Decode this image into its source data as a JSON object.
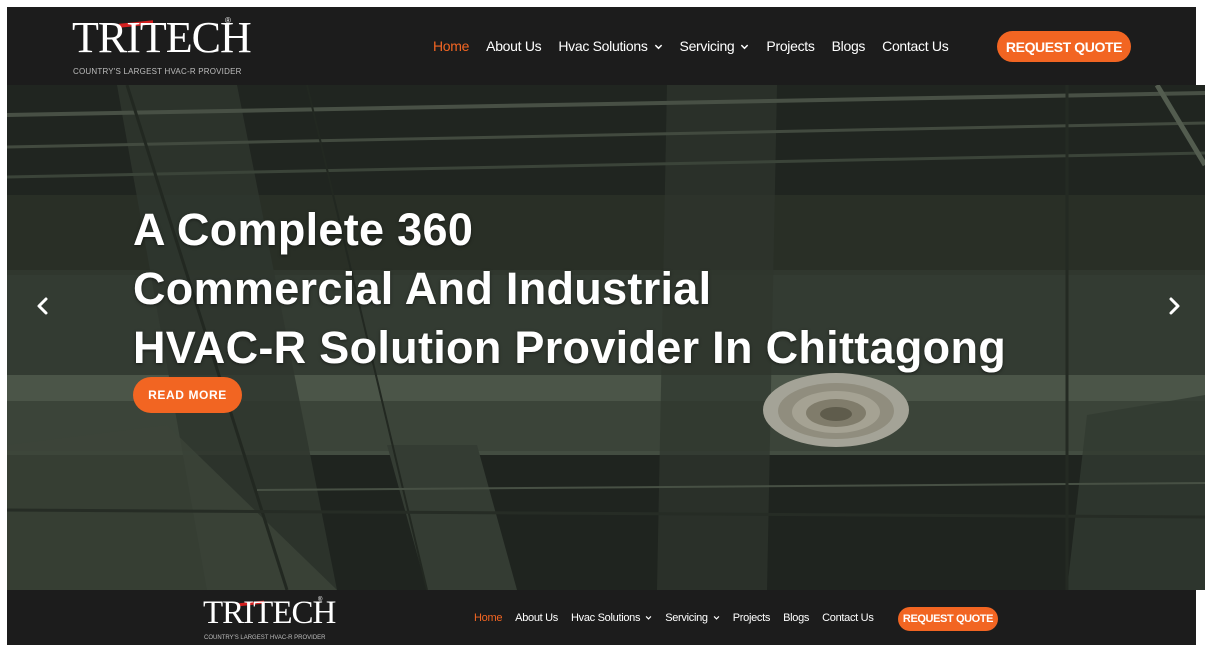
{
  "brand": {
    "name": "TRITECH",
    "tagline": "COUNTRY'S LARGEST HVAC-R PROVIDER",
    "registered": "®"
  },
  "nav": {
    "items": [
      {
        "label": "Home",
        "active": true
      },
      {
        "label": "About Us"
      },
      {
        "label": "Hvac Solutions",
        "dropdown": true
      },
      {
        "label": "Servicing",
        "dropdown": true
      },
      {
        "label": "Projects"
      },
      {
        "label": "Blogs"
      },
      {
        "label": "Contact Us"
      }
    ],
    "cta": "REQUEST QUOTE"
  },
  "hero": {
    "lines": [
      "A Complete 360",
      "Commercial And Industrial",
      "HVAC-R Solution Provider In Chittagong"
    ],
    "button": "READ MORE",
    "prev_icon": "chevron-left-icon",
    "next_icon": "chevron-right-icon"
  },
  "colors": {
    "accent": "#f26522",
    "nav_bg": "#1c1c1c",
    "logo_red": "#d42020"
  }
}
